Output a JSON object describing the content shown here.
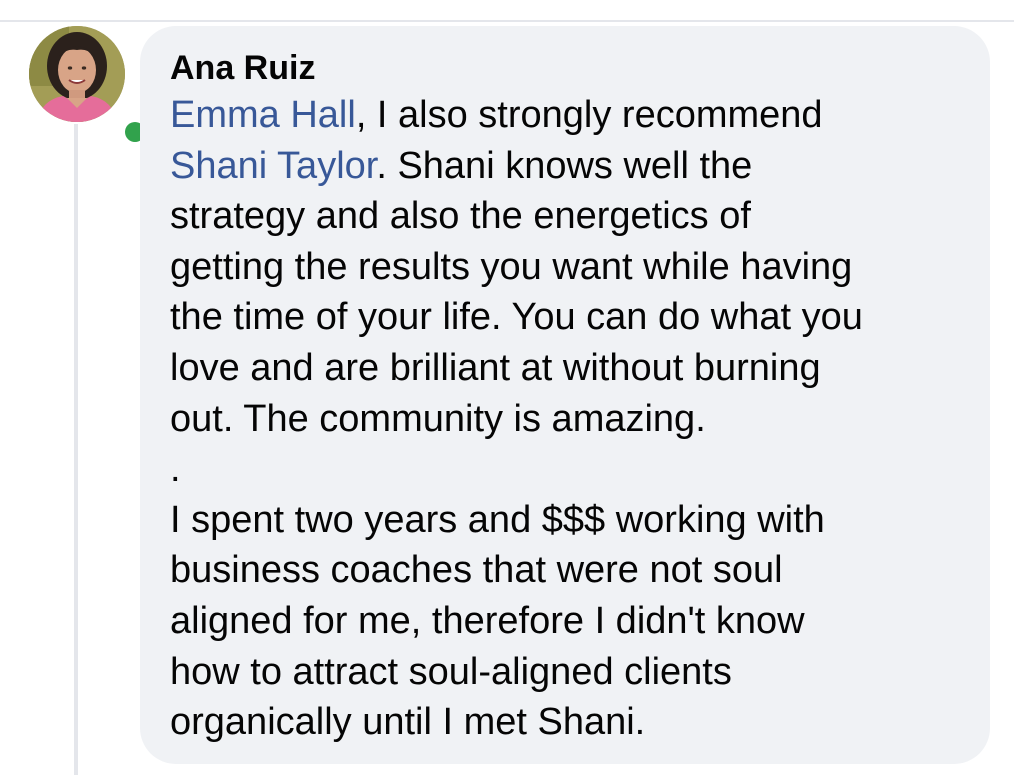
{
  "comment": {
    "author": "Ana Ruiz",
    "avatar_icon": "profile-photo",
    "online_status_color": "#31a24c",
    "mention_color": "#385898",
    "bubble_color": "#f0f2f5",
    "mentions": [
      "Emma Hall",
      "Shani Taylor"
    ],
    "lines": [
      [
        {
          "text": "Emma Hall",
          "mention": true
        },
        {
          "text": ", I also strongly recommend"
        }
      ],
      [
        {
          "text": "Shani Taylor",
          "mention": true
        },
        {
          "text": ". Shani knows well the"
        }
      ],
      [
        {
          "text": "strategy and also the energetics of"
        }
      ],
      [
        {
          "text": "getting the results you want while having"
        }
      ],
      [
        {
          "text": "the time of your life. You can do what you"
        }
      ],
      [
        {
          "text": "love and are brilliant at without burning"
        }
      ],
      [
        {
          "text": "out. The community is amazing."
        }
      ],
      [
        {
          "text": "."
        }
      ],
      [
        {
          "text": "I spent two years and $$$ working with"
        }
      ],
      [
        {
          "text": "business coaches that were not soul"
        }
      ],
      [
        {
          "text": "aligned for me, therefore I didn't know"
        }
      ],
      [
        {
          "text": "how to attract soul-aligned clients"
        }
      ],
      [
        {
          "text": "organically until I met Shani."
        }
      ]
    ]
  }
}
